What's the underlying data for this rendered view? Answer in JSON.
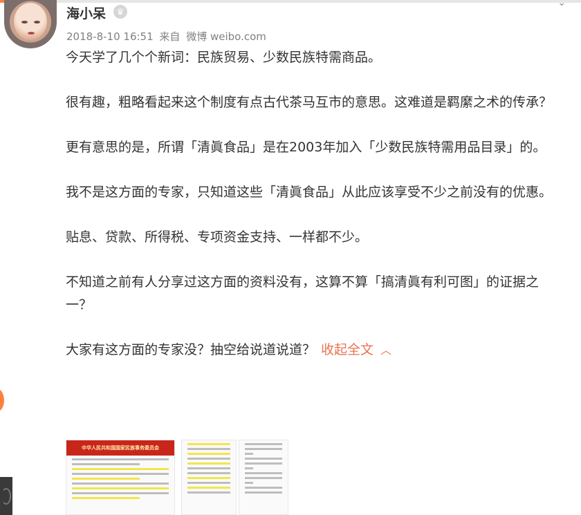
{
  "post": {
    "username": "海小呆",
    "vip_icon": "crown-icon",
    "timestamp": "2018-8-10 16:51",
    "source_prefix": "来自",
    "source_name": "微博 weibo.com",
    "paragraphs": [
      "今天学了几个个新词：民族贸易、少数民族特需商品。",
      "很有趣，粗略看起来这个制度有点古代茶马互市的意思。这难道是羁縻之术的传承？",
      "更有意思的是，所谓「清眞食品」是在2003年加入「少数民族特需用品目录」的。",
      "我不是这方面的专家，只知道这些「清眞食品」从此应该享受不少之前没有的优惠。",
      "贴息、贷款、所得税、专项资金支持、一样都不少。",
      "不知道之前有人分享过这方面的资料没有，这算不算「搞清眞有利可图」的证据之一？"
    ],
    "last_paragraph": "大家有这方面的专家没？抽空给说道说道？",
    "collapse_label": "收起全文",
    "collapse_icon": "chevron-up-icon",
    "colors": {
      "accent": "#eb7350",
      "brand_orange": "#ff8140",
      "text": "#333333",
      "meta": "#808080"
    }
  },
  "images": [
    {
      "header_text": "中华人民共和国国家民族事务委员会"
    },
    {
      "header_text": ""
    },
    {
      "header_text": ""
    }
  ]
}
